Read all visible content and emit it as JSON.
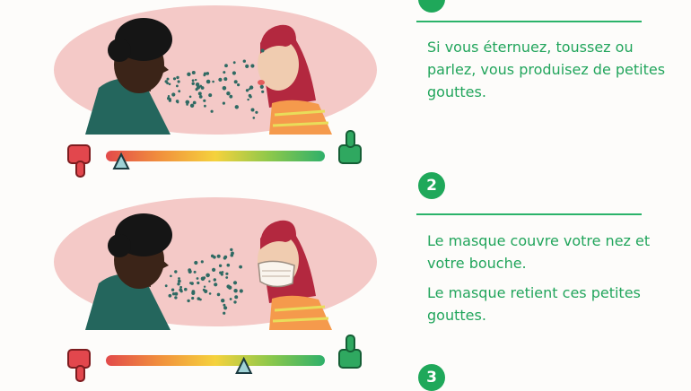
{
  "colors": {
    "accent_green": "#1fa85a",
    "text_green": "#22a55c",
    "bubble_pink": "#f4c9c7",
    "thumb_red": "#e2474d",
    "thumb_green": "#2fa860",
    "scale_gradient": [
      "#e24a4a",
      "#f1913d",
      "#f5d23d",
      "#8cc84b",
      "#2fb06a"
    ]
  },
  "icons": [
    "thumbs-down-icon",
    "thumbs-up-icon",
    "triangle-pointer-icon"
  ],
  "steps": [
    {
      "number": "",
      "paragraphs": [
        "Si vous éternuez, toussez ou parlez, vous produisez de petites gouttes."
      ],
      "risk_level_fraction": 0.07
    },
    {
      "number": "2",
      "paragraphs": [
        "Le masque couvre votre nez et votre bouche.",
        "Le masque retient ces petites gouttes."
      ],
      "risk_level_fraction": 0.63
    },
    {
      "number": "3",
      "paragraphs": []
    }
  ]
}
